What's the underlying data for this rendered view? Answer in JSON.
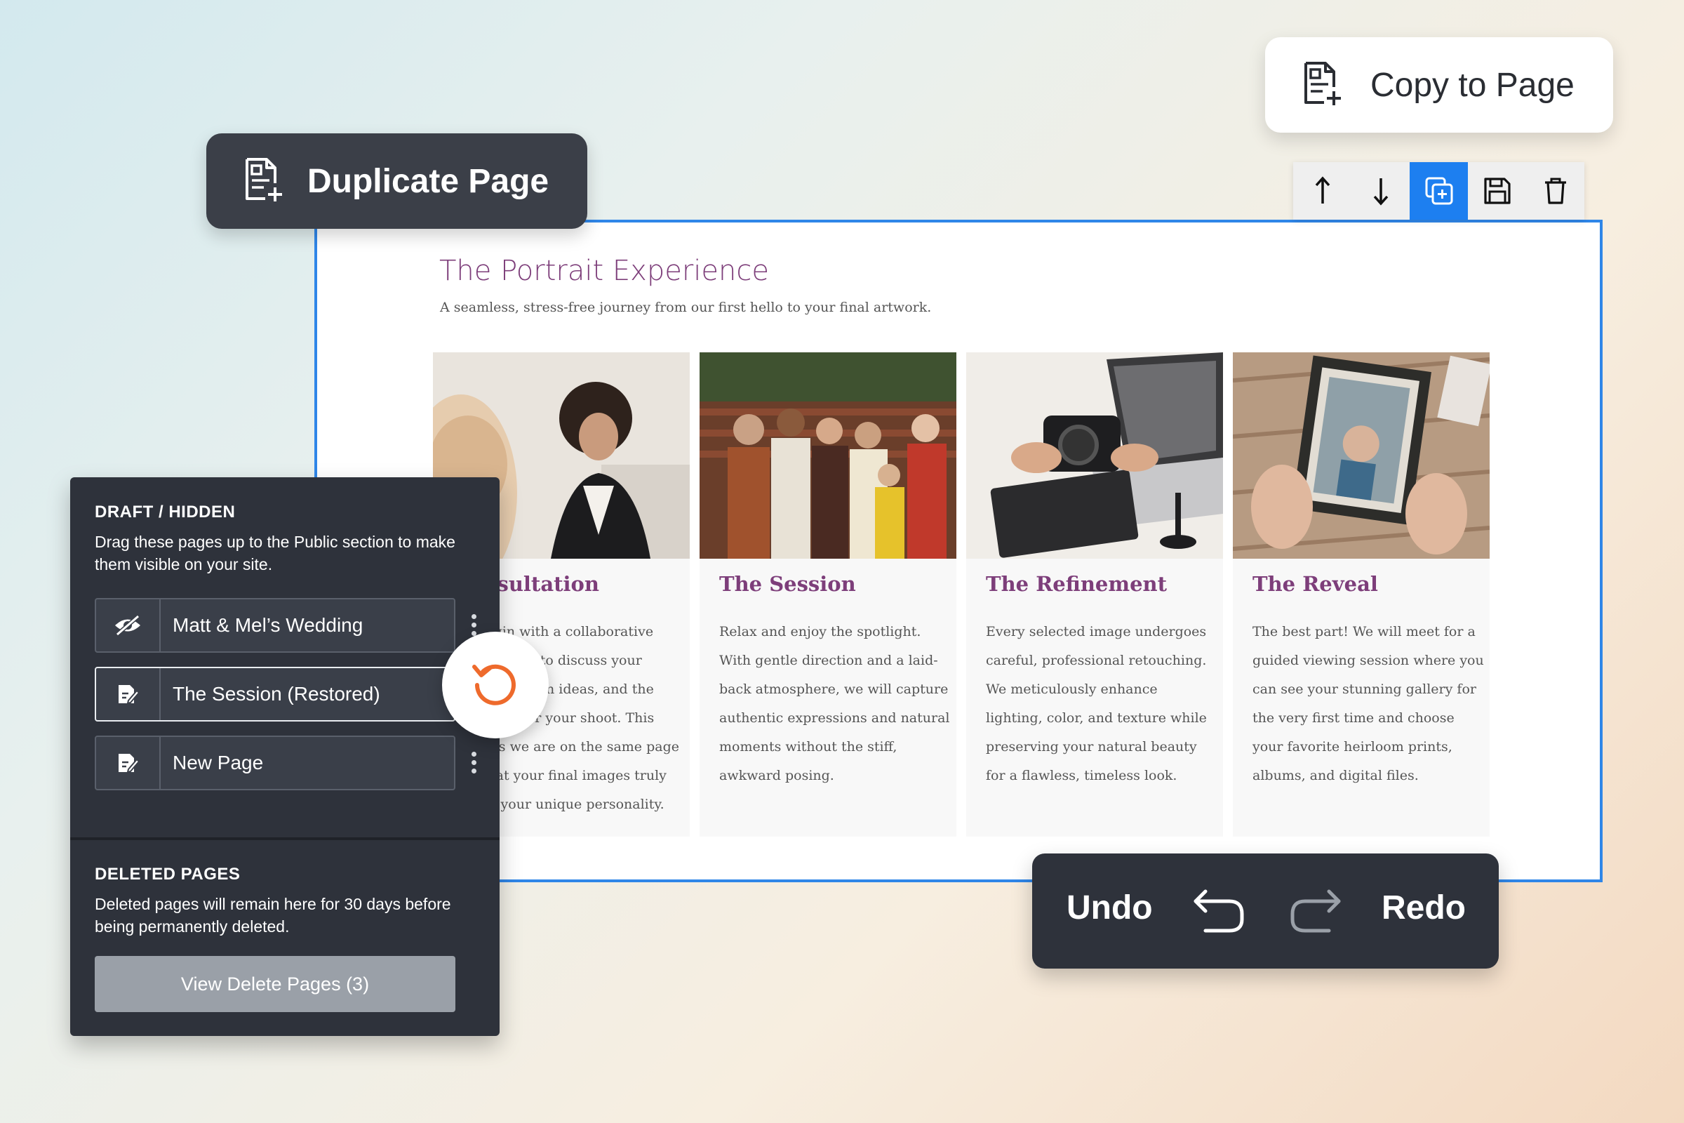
{
  "duplicate_pill": {
    "label": "Duplicate Page",
    "icon": "duplicate-page-icon"
  },
  "copy_pill": {
    "label": "Copy to Page",
    "icon": "copy-to-page-icon"
  },
  "toolbar": {
    "buttons": [
      {
        "name": "move-up",
        "icon": "arrow-up-icon"
      },
      {
        "name": "move-down",
        "icon": "arrow-down-icon"
      },
      {
        "name": "duplicate",
        "icon": "duplicate-icon",
        "active": true
      },
      {
        "name": "save",
        "icon": "save-icon"
      },
      {
        "name": "delete",
        "icon": "trash-icon"
      }
    ],
    "active_color": "#1d7ff0"
  },
  "preview": {
    "title": "The Portrait Experience",
    "subtitle": "A seamless, stress-free journey from our first hello to your final artwork.",
    "accent_color": "#7d3e7a",
    "cards": [
      {
        "title": "Consultation",
        "body": "We begin with a collaborative consultation to discuss your vision, location ideas, and the wardrobe for your shoot. This ensures we are on the same page and that your final images truly reflect your unique personality."
      },
      {
        "title": "The Session",
        "body": "Relax and enjoy the spotlight. With gentle direction and a laid-back atmosphere, we will capture authentic expressions and natural moments without the stiff, awkward posing."
      },
      {
        "title": "The Refinement",
        "body": "Every selected image undergoes careful, professional retouching. We meticulously enhance lighting, color, and texture while preserving your natural beauty for a flawless, timeless look."
      },
      {
        "title": "The Reveal",
        "body": "The best part! We will meet for a guided viewing session where you can see your stunning gallery for the very first time and choose your favorite heirloom prints, albums, and digital files."
      }
    ]
  },
  "panel": {
    "draft_heading": "DRAFT / HIDDEN",
    "draft_text": "Drag these pages up to the Public section to make them visible on your site.",
    "pages": [
      {
        "label": "Matt & Mel’s Wedding",
        "icon": "hidden-eye-icon",
        "selected": false
      },
      {
        "label": "The Session (Restored)",
        "icon": "draft-edit-icon",
        "selected": true
      },
      {
        "label": "New Page",
        "icon": "draft-edit-icon",
        "selected": false
      }
    ],
    "deleted_heading": "DELETED PAGES",
    "deleted_text": "Deleted pages will remain here for 30 days before being permanently deleted.",
    "view_button": "View Delete Pages (3)"
  },
  "restore": {
    "icon": "restore-icon",
    "color": "#ee6a2c"
  },
  "history": {
    "undo_label": "Undo",
    "redo_label": "Redo"
  }
}
